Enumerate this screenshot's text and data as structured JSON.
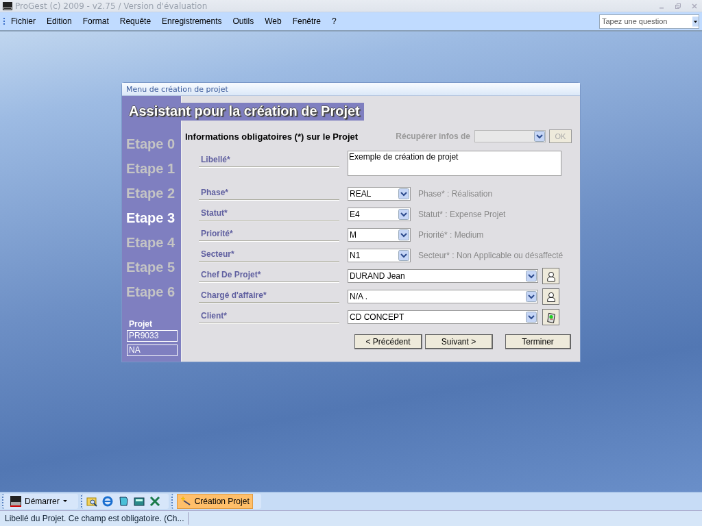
{
  "window": {
    "title": "ProGest (c) 2009 - v2.75 / Version d'évaluation"
  },
  "menu": [
    "Fichier",
    "Edition",
    "Format",
    "Requête",
    "Enregistrements",
    "Outils",
    "Web",
    "Fenêtre",
    "?"
  ],
  "help_search": {
    "placeholder": "Tapez une question"
  },
  "dialog": {
    "title": "Menu de création de projet",
    "heading": "Assistant pour la création de Projet",
    "steps": [
      {
        "label": "Etape 0",
        "selected": false
      },
      {
        "label": "Etape 1",
        "selected": false
      },
      {
        "label": "Etape 2",
        "selected": false
      },
      {
        "label": "Etape 3",
        "selected": true
      },
      {
        "label": "Etape 4",
        "selected": false
      },
      {
        "label": "Etape 5",
        "selected": false
      },
      {
        "label": "Etape 6",
        "selected": false
      }
    ],
    "project_label": "Projet",
    "project_fields": [
      "PR9033",
      "NA"
    ],
    "section_title": "Informations obligatoires (*) sur le Projet",
    "fetch": {
      "label": "Récupérer infos de",
      "button": "OK",
      "disabled": true
    },
    "fields": [
      {
        "kind": "textarea",
        "label": "Libellé*",
        "value": "Exemple de création de projet"
      },
      {
        "kind": "short",
        "label": "Phase*",
        "value": "REAL",
        "description": "Phase* : Réalisation"
      },
      {
        "kind": "short",
        "label": "Statut*",
        "value": "E4",
        "description": "Statut* : Expense Projet"
      },
      {
        "kind": "short",
        "label": "Priorité*",
        "value": "M",
        "description": "Priorité* : Medium"
      },
      {
        "kind": "short",
        "label": "Secteur*",
        "value": "N1",
        "description": "Secteur* : Non Applicable ou désaffecté"
      },
      {
        "kind": "person",
        "label": "Chef De Projet*",
        "value": "DURAND Jean"
      },
      {
        "kind": "person",
        "label": "Chargé d'affaire*",
        "value": "N/A ."
      },
      {
        "kind": "client",
        "label": "Client*",
        "value": "CD CONCEPT"
      }
    ],
    "buttons": [
      "< Précédent",
      "Suivant >",
      "Terminer"
    ]
  },
  "taskbar": {
    "start": "Démarrer",
    "task": {
      "label": "Création Projet",
      "selected": true
    }
  },
  "status_bar": [
    "Libellé du Projet. Ce champ est obligatoire. (Ch..."
  ]
}
